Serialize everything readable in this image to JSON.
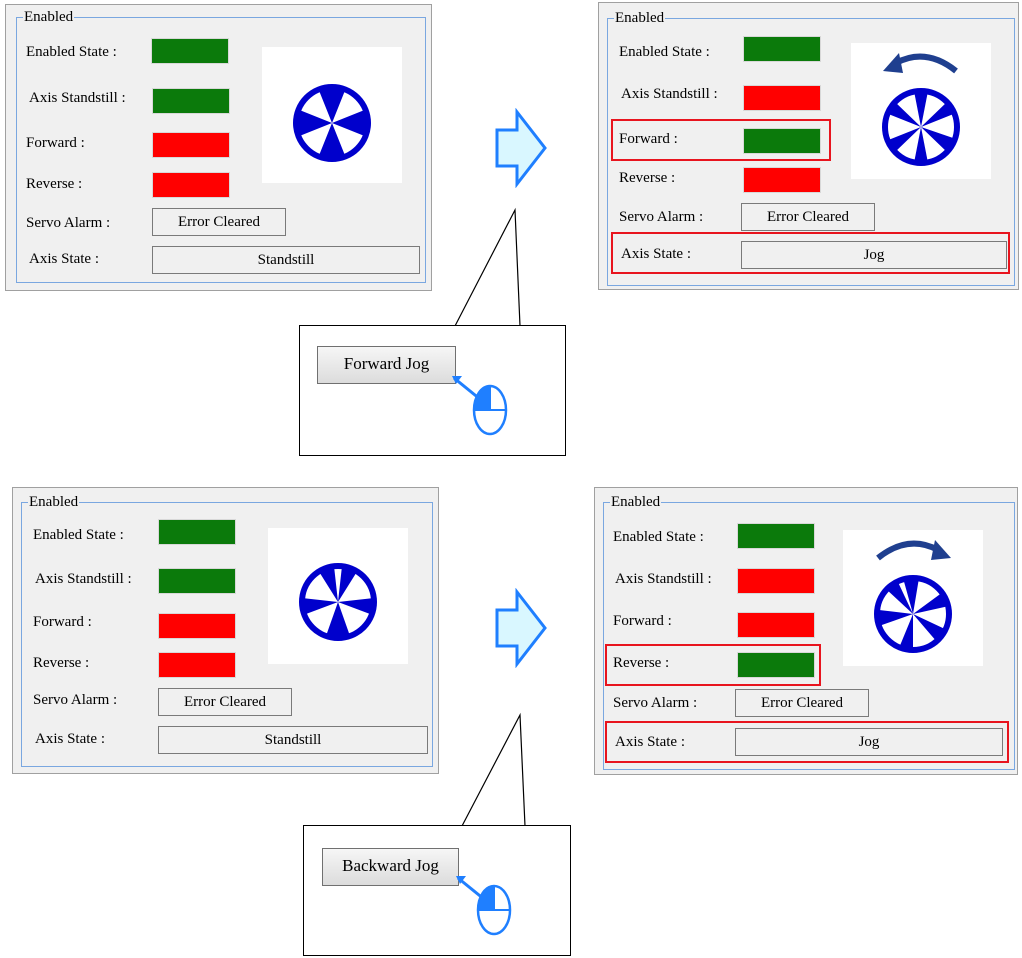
{
  "labels": {
    "group": "Enabled",
    "enabled_state": "Enabled State :",
    "axis_standstill": "Axis Standstill :",
    "forward": "Forward :",
    "reverse": "Reverse :",
    "servo_alarm": "Servo Alarm :",
    "axis_state": "Axis State :"
  },
  "values": {
    "error_cleared": "Error Cleared",
    "standstill": "Standstill",
    "jog": "Jog"
  },
  "buttons": {
    "forward_jog": "Forward Jog",
    "backward_jog": "Backward Jog"
  },
  "colors": {
    "lamp_on": "#0b7a0b",
    "lamp_off": "#ff0000",
    "highlight": "#e8141e",
    "wheel": "#0000cc",
    "arrow_fill": "#d9f7ff",
    "arrow_stroke": "#1f7fff"
  },
  "lamp_states": {
    "panel_top_left": {
      "enabled_state": "on",
      "axis_standstill": "on",
      "forward": "off",
      "reverse": "off"
    },
    "panel_top_right": {
      "enabled_state": "on",
      "axis_standstill": "off",
      "forward": "on",
      "reverse": "off"
    },
    "panel_bottom_left": {
      "enabled_state": "on",
      "axis_standstill": "on",
      "forward": "off",
      "reverse": "off"
    },
    "panel_bottom_right": {
      "enabled_state": "on",
      "axis_standstill": "off",
      "forward": "off",
      "reverse": "on"
    }
  },
  "icons": [
    "wheel-icon",
    "rotation-ccw-arrow-icon",
    "rotation-cw-arrow-icon",
    "transition-arrow-icon",
    "mouse-left-click-icon"
  ]
}
